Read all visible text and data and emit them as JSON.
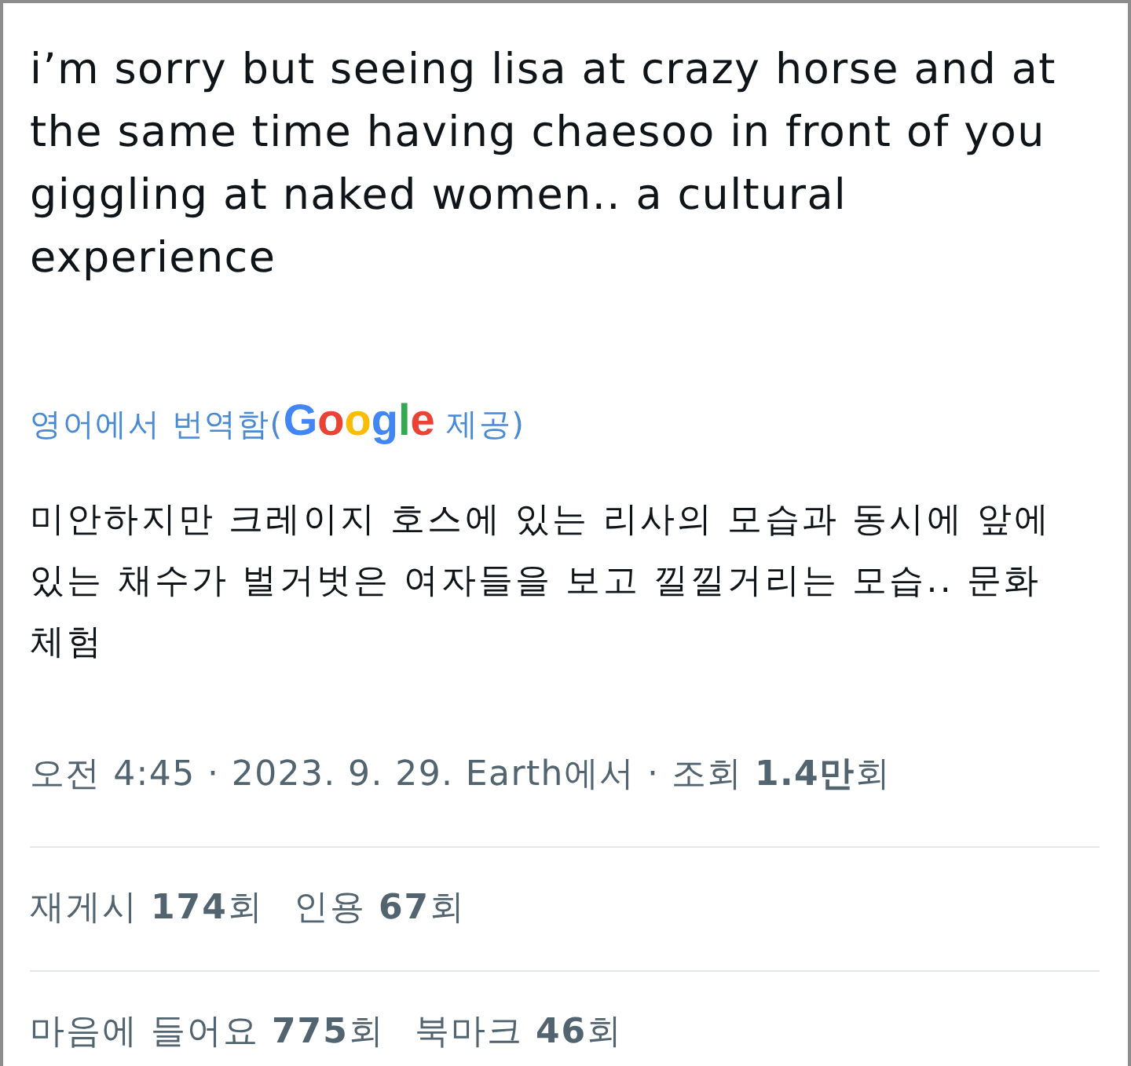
{
  "tweet": {
    "text": "i’m sorry but seeing lisa at crazy horse and at the same time having chaesoo in front of you giggling at naked women.. a cultural experience",
    "translation_note": {
      "before": "영어에서 번역함(",
      "brand": "Google",
      "after": " 제공)"
    },
    "translated_text": "미안하지만 크레이지 호스에 있는 리사의 모습과 동시에 앞에 있는 채수가 벌거벗은 여자들을 보고 낄낄거리는 모습.. 문화 체험",
    "meta": "오전 4:45 · 2023. 9. 29. Earth에서 · 조회 **1.4만**회",
    "stat_rows": [
      {
        "items": [
          "재게시 **174**회",
          "인용 **67**회"
        ]
      },
      {
        "items": [
          "마음에 들어요 **775**회",
          "북마크 **46**회"
        ]
      }
    ]
  }
}
